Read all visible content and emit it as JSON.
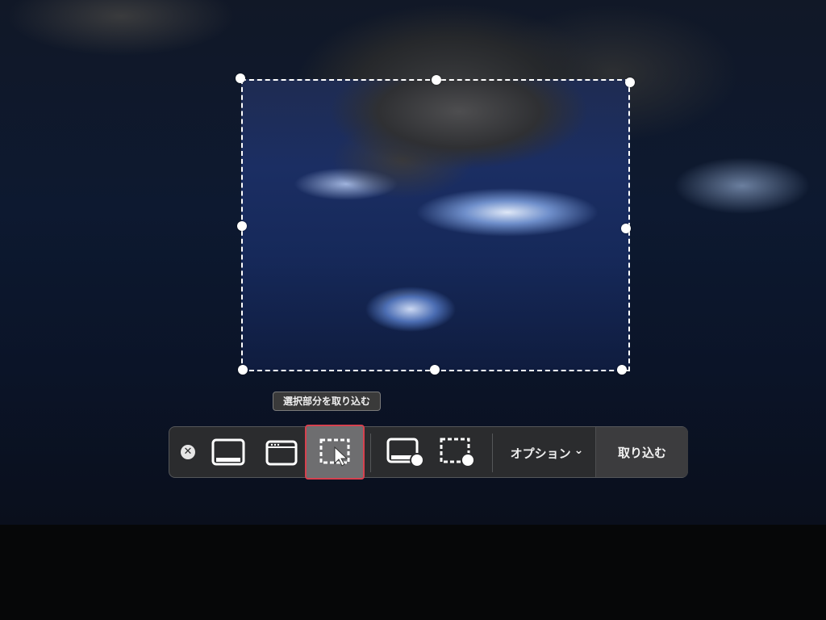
{
  "tooltip": {
    "text": "選択部分を取り込む"
  },
  "toolbar": {
    "close_icon": "close-icon",
    "buttons": [
      {
        "icon": "capture-entire-screen-icon",
        "selected": false
      },
      {
        "icon": "capture-window-icon",
        "selected": false
      },
      {
        "icon": "capture-selection-icon",
        "selected": true
      },
      {
        "icon": "record-entire-screen-icon",
        "selected": false
      },
      {
        "icon": "record-selection-icon",
        "selected": false
      }
    ],
    "options_label": "オプション",
    "options_chevron": "⌄",
    "capture_label": "取り込む"
  },
  "colors": {
    "toolbar_bg": "#2b2c2e",
    "selected_bg": "#6e6e70",
    "highlight_outline": "#d6414f",
    "icon_white": "#ffffff"
  }
}
